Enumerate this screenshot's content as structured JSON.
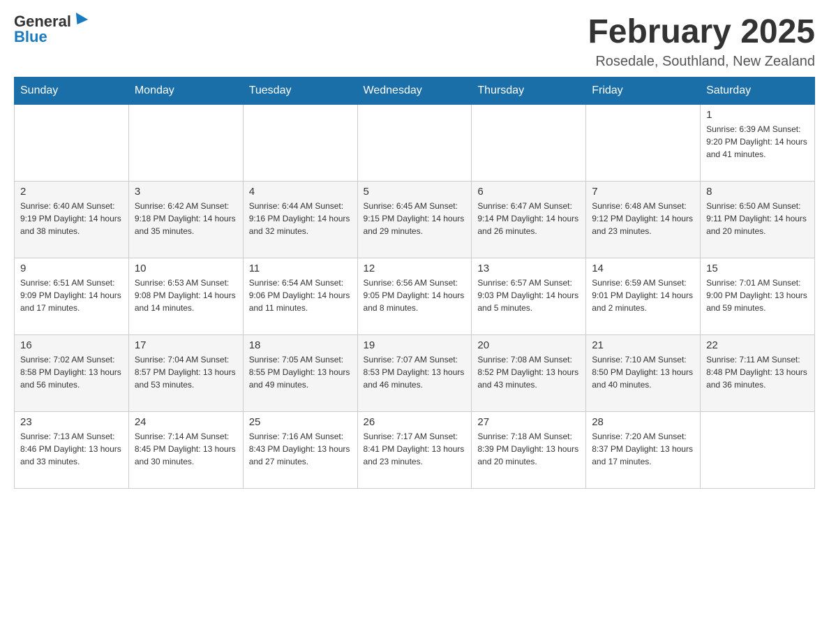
{
  "header": {
    "logo_general": "General",
    "logo_blue": "Blue",
    "month_title": "February 2025",
    "location": "Rosedale, Southland, New Zealand"
  },
  "days_of_week": [
    "Sunday",
    "Monday",
    "Tuesday",
    "Wednesday",
    "Thursday",
    "Friday",
    "Saturday"
  ],
  "weeks": [
    {
      "days": [
        {
          "number": "",
          "info": ""
        },
        {
          "number": "",
          "info": ""
        },
        {
          "number": "",
          "info": ""
        },
        {
          "number": "",
          "info": ""
        },
        {
          "number": "",
          "info": ""
        },
        {
          "number": "",
          "info": ""
        },
        {
          "number": "1",
          "info": "Sunrise: 6:39 AM\nSunset: 9:20 PM\nDaylight: 14 hours and 41 minutes."
        }
      ]
    },
    {
      "days": [
        {
          "number": "2",
          "info": "Sunrise: 6:40 AM\nSunset: 9:19 PM\nDaylight: 14 hours and 38 minutes."
        },
        {
          "number": "3",
          "info": "Sunrise: 6:42 AM\nSunset: 9:18 PM\nDaylight: 14 hours and 35 minutes."
        },
        {
          "number": "4",
          "info": "Sunrise: 6:44 AM\nSunset: 9:16 PM\nDaylight: 14 hours and 32 minutes."
        },
        {
          "number": "5",
          "info": "Sunrise: 6:45 AM\nSunset: 9:15 PM\nDaylight: 14 hours and 29 minutes."
        },
        {
          "number": "6",
          "info": "Sunrise: 6:47 AM\nSunset: 9:14 PM\nDaylight: 14 hours and 26 minutes."
        },
        {
          "number": "7",
          "info": "Sunrise: 6:48 AM\nSunset: 9:12 PM\nDaylight: 14 hours and 23 minutes."
        },
        {
          "number": "8",
          "info": "Sunrise: 6:50 AM\nSunset: 9:11 PM\nDaylight: 14 hours and 20 minutes."
        }
      ]
    },
    {
      "days": [
        {
          "number": "9",
          "info": "Sunrise: 6:51 AM\nSunset: 9:09 PM\nDaylight: 14 hours and 17 minutes."
        },
        {
          "number": "10",
          "info": "Sunrise: 6:53 AM\nSunset: 9:08 PM\nDaylight: 14 hours and 14 minutes."
        },
        {
          "number": "11",
          "info": "Sunrise: 6:54 AM\nSunset: 9:06 PM\nDaylight: 14 hours and 11 minutes."
        },
        {
          "number": "12",
          "info": "Sunrise: 6:56 AM\nSunset: 9:05 PM\nDaylight: 14 hours and 8 minutes."
        },
        {
          "number": "13",
          "info": "Sunrise: 6:57 AM\nSunset: 9:03 PM\nDaylight: 14 hours and 5 minutes."
        },
        {
          "number": "14",
          "info": "Sunrise: 6:59 AM\nSunset: 9:01 PM\nDaylight: 14 hours and 2 minutes."
        },
        {
          "number": "15",
          "info": "Sunrise: 7:01 AM\nSunset: 9:00 PM\nDaylight: 13 hours and 59 minutes."
        }
      ]
    },
    {
      "days": [
        {
          "number": "16",
          "info": "Sunrise: 7:02 AM\nSunset: 8:58 PM\nDaylight: 13 hours and 56 minutes."
        },
        {
          "number": "17",
          "info": "Sunrise: 7:04 AM\nSunset: 8:57 PM\nDaylight: 13 hours and 53 minutes."
        },
        {
          "number": "18",
          "info": "Sunrise: 7:05 AM\nSunset: 8:55 PM\nDaylight: 13 hours and 49 minutes."
        },
        {
          "number": "19",
          "info": "Sunrise: 7:07 AM\nSunset: 8:53 PM\nDaylight: 13 hours and 46 minutes."
        },
        {
          "number": "20",
          "info": "Sunrise: 7:08 AM\nSunset: 8:52 PM\nDaylight: 13 hours and 43 minutes."
        },
        {
          "number": "21",
          "info": "Sunrise: 7:10 AM\nSunset: 8:50 PM\nDaylight: 13 hours and 40 minutes."
        },
        {
          "number": "22",
          "info": "Sunrise: 7:11 AM\nSunset: 8:48 PM\nDaylight: 13 hours and 36 minutes."
        }
      ]
    },
    {
      "days": [
        {
          "number": "23",
          "info": "Sunrise: 7:13 AM\nSunset: 8:46 PM\nDaylight: 13 hours and 33 minutes."
        },
        {
          "number": "24",
          "info": "Sunrise: 7:14 AM\nSunset: 8:45 PM\nDaylight: 13 hours and 30 minutes."
        },
        {
          "number": "25",
          "info": "Sunrise: 7:16 AM\nSunset: 8:43 PM\nDaylight: 13 hours and 27 minutes."
        },
        {
          "number": "26",
          "info": "Sunrise: 7:17 AM\nSunset: 8:41 PM\nDaylight: 13 hours and 23 minutes."
        },
        {
          "number": "27",
          "info": "Sunrise: 7:18 AM\nSunset: 8:39 PM\nDaylight: 13 hours and 20 minutes."
        },
        {
          "number": "28",
          "info": "Sunrise: 7:20 AM\nSunset: 8:37 PM\nDaylight: 13 hours and 17 minutes."
        },
        {
          "number": "",
          "info": ""
        }
      ]
    }
  ]
}
